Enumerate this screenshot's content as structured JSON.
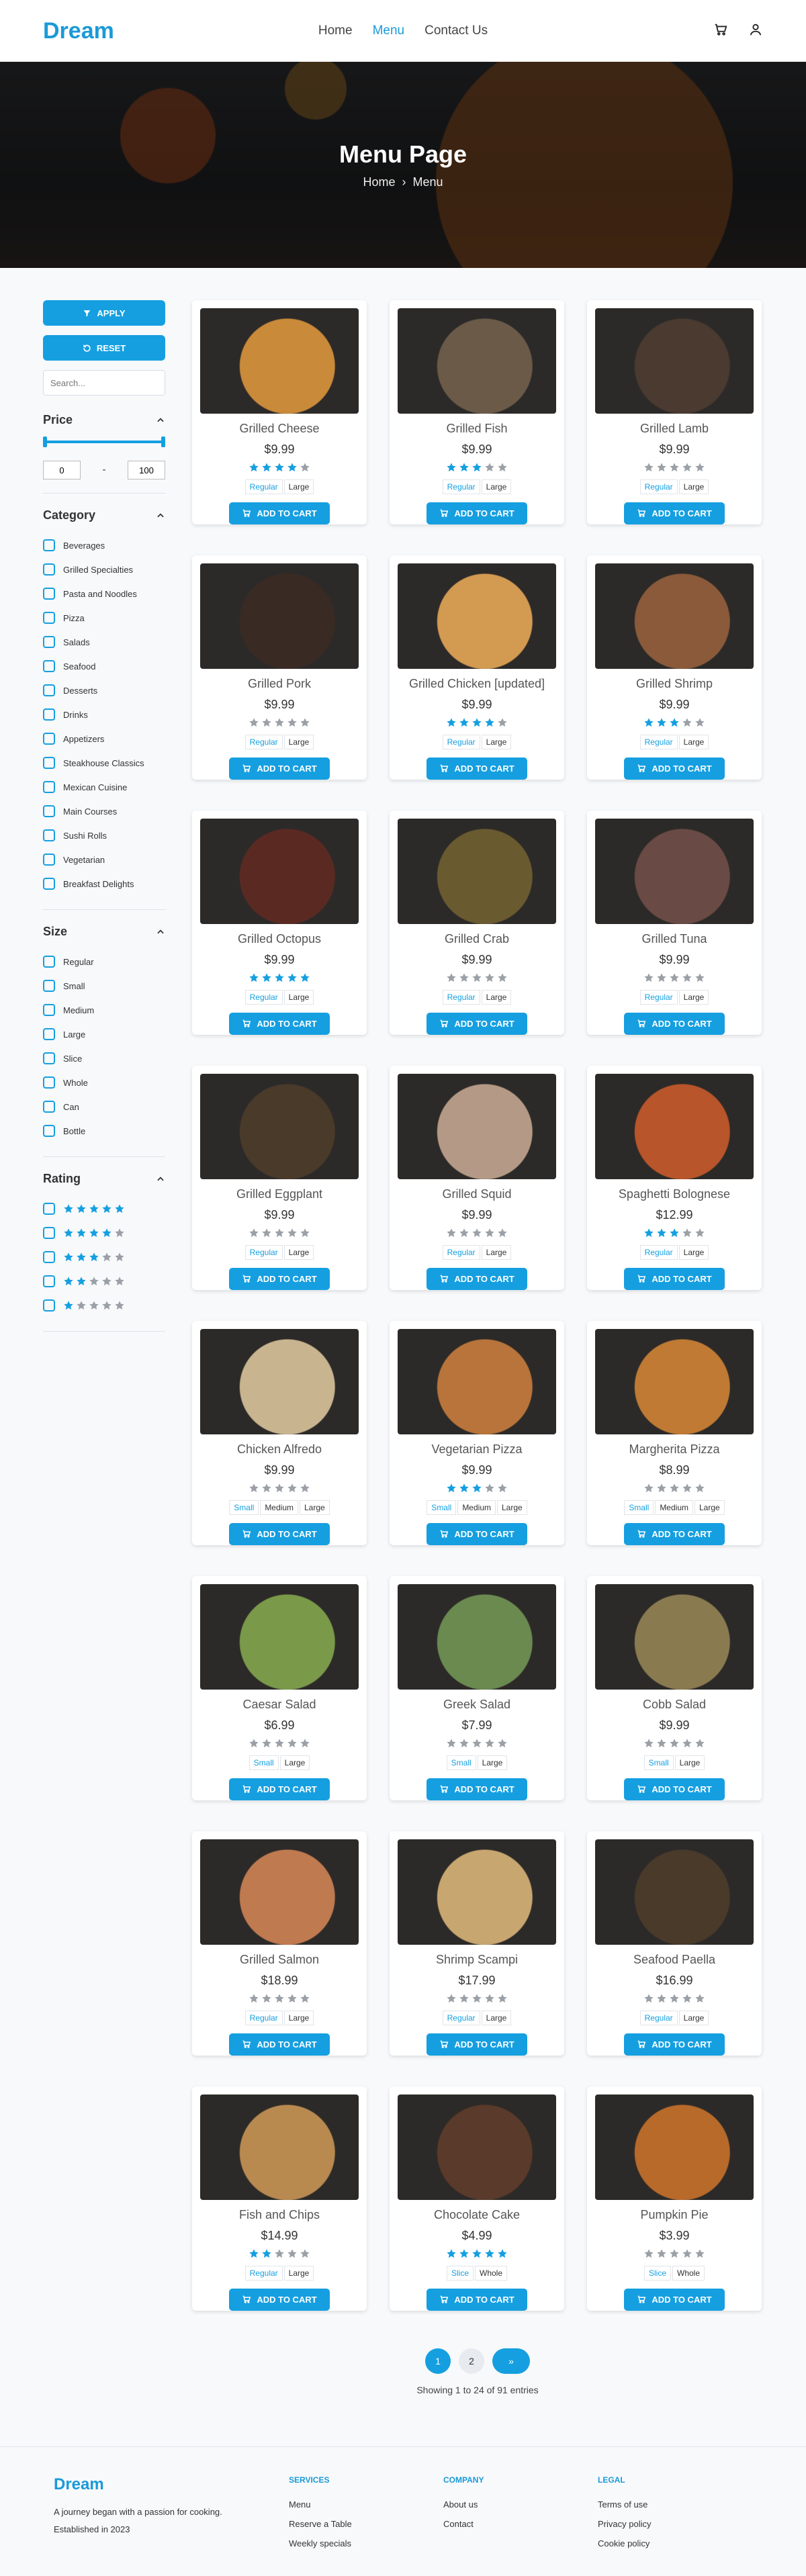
{
  "header": {
    "logo": "Dream",
    "nav": [
      "Home",
      "Menu",
      "Contact Us"
    ],
    "active_nav": "Menu",
    "icons": [
      "cart-icon",
      "user-icon"
    ]
  },
  "hero": {
    "title": "Menu Page",
    "crumb_home": "Home",
    "crumb_current": "Menu"
  },
  "sidebar": {
    "apply_label": "APPLY",
    "reset_label": "RESET",
    "search_placeholder": "Search...",
    "price_title": "Price",
    "price_min": "0",
    "price_max": "100",
    "price_separator": "-",
    "category_title": "Category",
    "categories": [
      "Beverages",
      "Grilled Specialties",
      "Pasta and Noodles",
      "Pizza",
      "Salads",
      "Seafood",
      "Desserts",
      "Drinks",
      "Appetizers",
      "Steakhouse Classics",
      "Mexican Cuisine",
      "Main Courses",
      "Sushi Rolls",
      "Vegetarian",
      "Breakfast Delights"
    ],
    "size_title": "Size",
    "sizes": [
      "Regular",
      "Small",
      "Medium",
      "Large",
      "Slice",
      "Whole",
      "Can",
      "Bottle"
    ],
    "rating_title": "Rating",
    "ratings": [
      5,
      4,
      3,
      2,
      1
    ]
  },
  "products": [
    {
      "name": "Grilled Cheese",
      "price": "$9.99",
      "rating": 4,
      "sizes": [
        "Regular",
        "Large"
      ],
      "color": "#c98a3a"
    },
    {
      "name": "Grilled Fish",
      "price": "$9.99",
      "rating": 3,
      "sizes": [
        "Regular",
        "Large"
      ],
      "color": "#6b5a48"
    },
    {
      "name": "Grilled Lamb",
      "price": "$9.99",
      "rating": 0,
      "sizes": [
        "Regular",
        "Large"
      ],
      "color": "#4a3a30"
    },
    {
      "name": "Grilled Pork",
      "price": "$9.99",
      "rating": 0,
      "sizes": [
        "Regular",
        "Large"
      ],
      "color": "#3a2a24"
    },
    {
      "name": "Grilled Chicken [updated]",
      "price": "$9.99",
      "rating": 4,
      "sizes": [
        "Regular",
        "Large"
      ],
      "color": "#d39a52"
    },
    {
      "name": "Grilled Shrimp",
      "price": "$9.99",
      "rating": 3,
      "sizes": [
        "Regular",
        "Large"
      ],
      "color": "#8a5a3a"
    },
    {
      "name": "Grilled Octopus",
      "price": "$9.99",
      "rating": 5,
      "sizes": [
        "Regular",
        "Large"
      ],
      "color": "#5a2a22"
    },
    {
      "name": "Grilled Crab",
      "price": "$9.99",
      "rating": 0,
      "sizes": [
        "Regular",
        "Large"
      ],
      "color": "#6a5a30"
    },
    {
      "name": "Grilled Tuna",
      "price": "$9.99",
      "rating": 0,
      "sizes": [
        "Regular",
        "Large"
      ],
      "color": "#6a4a44"
    },
    {
      "name": "Grilled Eggplant",
      "price": "$9.99",
      "rating": 0,
      "sizes": [
        "Regular",
        "Large"
      ],
      "color": "#4a3a2a"
    },
    {
      "name": "Grilled Squid",
      "price": "$9.99",
      "rating": 0,
      "sizes": [
        "Regular",
        "Large"
      ],
      "color": "#b49a86"
    },
    {
      "name": "Spaghetti Bolognese",
      "price": "$12.99",
      "rating": 3,
      "sizes": [
        "Regular",
        "Large"
      ],
      "color": "#b8552a"
    },
    {
      "name": "Chicken Alfredo",
      "price": "$9.99",
      "rating": 0,
      "sizes": [
        "Small",
        "Medium",
        "Large"
      ],
      "color": "#c8b590"
    },
    {
      "name": "Vegetarian Pizza",
      "price": "$9.99",
      "rating": 3,
      "sizes": [
        "Small",
        "Medium",
        "Large"
      ],
      "color": "#b8743a"
    },
    {
      "name": "Margherita Pizza",
      "price": "$8.99",
      "rating": 0,
      "sizes": [
        "Small",
        "Medium",
        "Large"
      ],
      "color": "#c07a34"
    },
    {
      "name": "Caesar Salad",
      "price": "$6.99",
      "rating": 0,
      "sizes": [
        "Small",
        "Large"
      ],
      "color": "#7a9a4a"
    },
    {
      "name": "Greek Salad",
      "price": "$7.99",
      "rating": 0,
      "sizes": [
        "Small",
        "Large"
      ],
      "color": "#6a8a50"
    },
    {
      "name": "Cobb Salad",
      "price": "$9.99",
      "rating": 0,
      "sizes": [
        "Small",
        "Large"
      ],
      "color": "#8a7a50"
    },
    {
      "name": "Grilled Salmon",
      "price": "$18.99",
      "rating": 0,
      "sizes": [
        "Regular",
        "Large"
      ],
      "color": "#c07a50"
    },
    {
      "name": "Shrimp Scampi",
      "price": "$17.99",
      "rating": 0,
      "sizes": [
        "Regular",
        "Large"
      ],
      "color": "#c8a670"
    },
    {
      "name": "Seafood Paella",
      "price": "$16.99",
      "rating": 0,
      "sizes": [
        "Regular",
        "Large"
      ],
      "color": "#4a3a2a"
    },
    {
      "name": "Fish and Chips",
      "price": "$14.99",
      "rating": 2,
      "sizes": [
        "Regular",
        "Large"
      ],
      "color": "#b88a50"
    },
    {
      "name": "Chocolate Cake",
      "price": "$4.99",
      "rating": 5,
      "sizes": [
        "Slice",
        "Whole"
      ],
      "color": "#5a3a2a"
    },
    {
      "name": "Pumpkin Pie",
      "price": "$3.99",
      "rating": 0,
      "sizes": [
        "Slice",
        "Whole"
      ],
      "color": "#b86a2a"
    }
  ],
  "add_to_cart_label": "ADD TO CART",
  "pagination": {
    "pages": [
      "1",
      "2"
    ],
    "current": "1",
    "next": "»",
    "showing": "Showing 1 to 24 of 91 entries"
  },
  "footer": {
    "logo": "Dream",
    "tagline": "A journey began with a passion for cooking. Established in 2023",
    "columns": [
      {
        "title": "SERVICES",
        "links": [
          "Menu",
          "Reserve a Table",
          "Weekly specials"
        ]
      },
      {
        "title": "COMPANY",
        "links": [
          "About us",
          "Contact"
        ]
      },
      {
        "title": "LEGAL",
        "links": [
          "Terms of use",
          "Privacy policy",
          "Cookie policy"
        ]
      }
    ]
  },
  "colors": {
    "accent": "#159fe0",
    "star_off": "#9aa0a6"
  }
}
